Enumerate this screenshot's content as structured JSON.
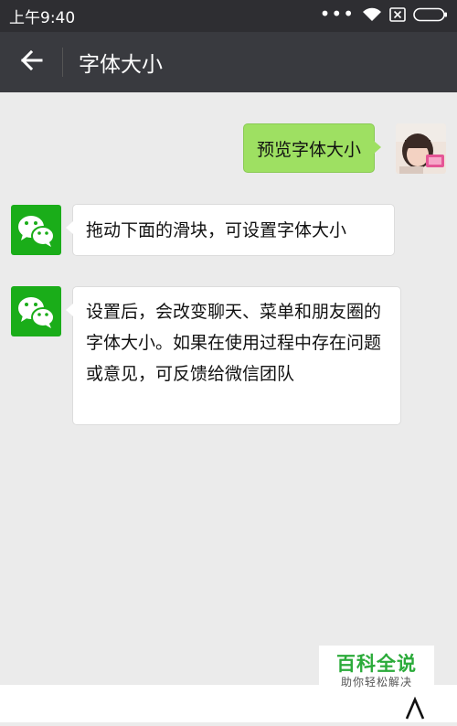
{
  "statusbar": {
    "time": "上午9:40",
    "icons": [
      "more-dots-icon",
      "wifi-icon",
      "sim-x-icon",
      "battery-icon"
    ]
  },
  "navbar": {
    "back_icon": "back-arrow-icon",
    "title": "字体大小"
  },
  "messages": [
    {
      "side": "right",
      "text": "预览字体大小"
    },
    {
      "side": "left",
      "text": "拖动下面的滑块，可设置字体大小"
    },
    {
      "side": "left",
      "text": "设置后，会改变聊天、菜单和朋友圈的字体大小。如果在使用过程中存在问题或意见，可反馈给微信团队"
    }
  ],
  "watermark": {
    "title": "百科全说",
    "subtitle": "助你轻松解决"
  },
  "colors": {
    "statusbar": "#2e2e32",
    "navbar": "#393a3f",
    "background": "#ebebeb",
    "bubble_self": "#9ee062",
    "wechat_green": "#1aad19"
  }
}
